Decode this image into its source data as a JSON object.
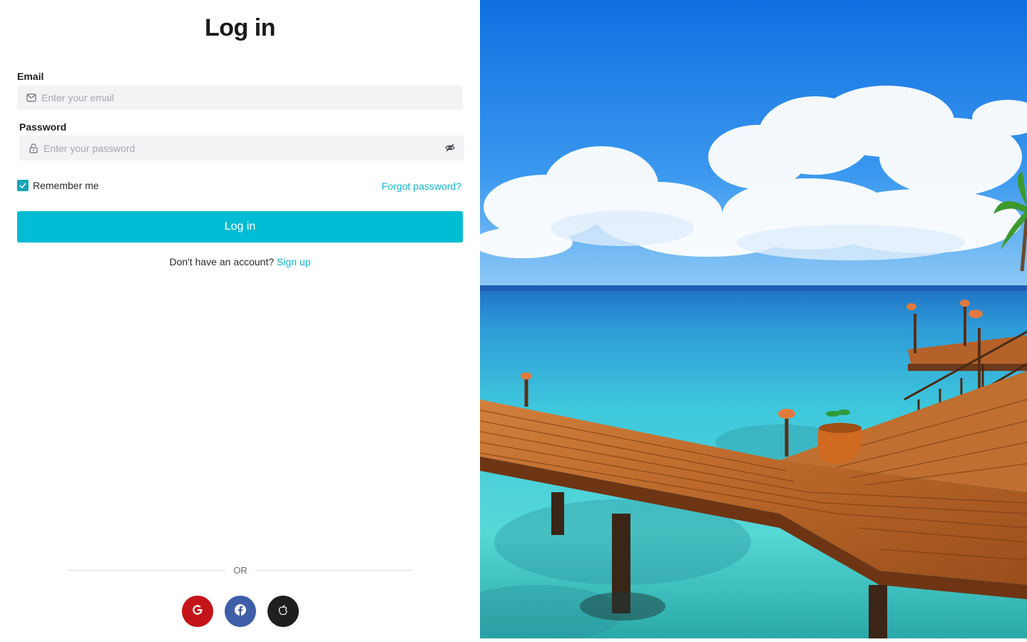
{
  "page": {
    "title": "Log in"
  },
  "form": {
    "email_label": "Email",
    "email_placeholder": "Enter your email",
    "password_label": "Password",
    "password_placeholder": "Enter your password",
    "remember_label": "Remember me",
    "remember_checked": true,
    "forgot_link": "Forgot password?",
    "submit_label": "Log in"
  },
  "signup": {
    "prompt": "Don't have an account?",
    "link": "Sign up"
  },
  "divider": {
    "text": "OR"
  },
  "social": [
    {
      "name": "google",
      "icon": "google-icon",
      "color": "#c4141a"
    },
    {
      "name": "facebook",
      "icon": "facebook-icon",
      "color": "#3f5ea8"
    },
    {
      "name": "apple",
      "icon": "apple-icon",
      "color": "#1d1f21"
    }
  ],
  "colors": {
    "accent": "#00bcd4",
    "link": "#12b5cb",
    "checkbox": "#1aa6b7"
  },
  "hero": {
    "icon": "tropical-beach-pier-image"
  }
}
